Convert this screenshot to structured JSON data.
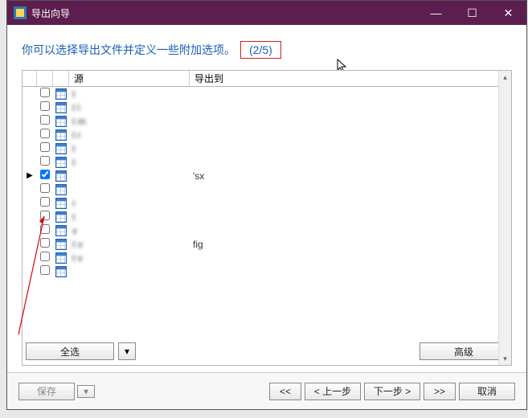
{
  "window": {
    "title": "导出向导"
  },
  "header": {
    "message": "你可以选择导出文件并定义一些附加选项。",
    "step": "(2/5)"
  },
  "grid": {
    "col_source": "源",
    "col_dest": "导出到",
    "rows": [
      {
        "checked": false,
        "source": "t",
        "dest": ""
      },
      {
        "checked": false,
        "source": "t l",
        "dest": ""
      },
      {
        "checked": false,
        "source": "t m",
        "dest": ""
      },
      {
        "checked": false,
        "source": "t r",
        "dest": ""
      },
      {
        "checked": false,
        "source": "t",
        "dest": ""
      },
      {
        "checked": false,
        "source": "t",
        "dest": ""
      },
      {
        "checked": true,
        "source": "",
        "dest": "'sx",
        "current": true
      },
      {
        "checked": false,
        "source": "",
        "dest": ""
      },
      {
        "checked": false,
        "source": "r",
        "dest": ""
      },
      {
        "checked": false,
        "source": "t",
        "dest": ""
      },
      {
        "checked": false,
        "source": "v",
        "dest": ""
      },
      {
        "checked": false,
        "source": "t v",
        "dest": "fig"
      },
      {
        "checked": false,
        "source": "t v",
        "dest": ""
      },
      {
        "checked": false,
        "source": "",
        "dest": ""
      }
    ]
  },
  "buttons": {
    "select_all": "全选",
    "advanced": "高级",
    "save": "保存",
    "first": "<<",
    "prev": "< 上一步",
    "next": "下一步 >",
    "last": ">>",
    "cancel": "取消"
  }
}
